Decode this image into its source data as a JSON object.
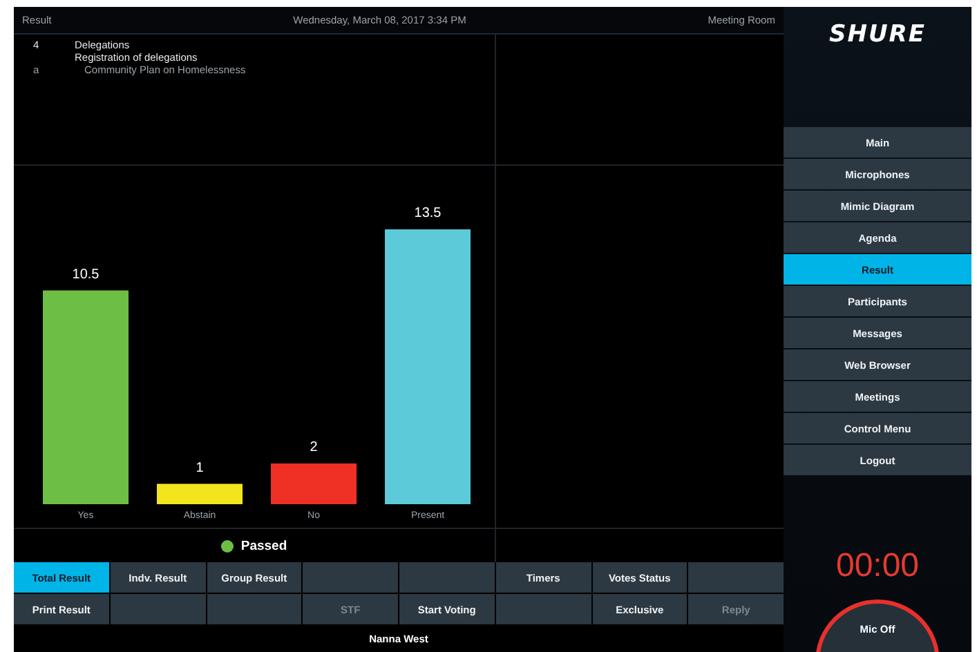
{
  "header": {
    "title": "Result",
    "datetime": "Wednesday, March 08, 2017 3:34 PM",
    "location": "Meeting Room"
  },
  "agenda": {
    "number": "4",
    "title": "Delegations",
    "subtitle": "Registration of delegations",
    "sub_number": "a",
    "sub_title": "Community Plan on Homelessness"
  },
  "chart": {
    "chart_data": {
      "type": "bar",
      "categories": [
        "Yes",
        "Abstain",
        "No",
        "Present"
      ],
      "values": [
        10.5,
        1,
        2,
        13.5
      ],
      "value_labels": [
        "10.5",
        "1",
        "2",
        "13.5"
      ],
      "colors": [
        "#6cbf44",
        "#f2e51e",
        "#ee3124",
        "#5ccad8"
      ],
      "data_labels": true
    }
  },
  "outcome": {
    "label": "Passed",
    "color": "#6cbf44"
  },
  "buttons": [
    [
      {
        "kind": "button",
        "label": "Total Result",
        "selected": true,
        "disabled": false
      },
      {
        "kind": "button",
        "label": "Indv. Result",
        "selected": false,
        "disabled": false
      },
      {
        "kind": "button",
        "label": "Group Result",
        "selected": false,
        "disabled": false
      },
      {
        "kind": "blank"
      },
      {
        "kind": "blank"
      },
      {
        "kind": "button",
        "label": "Timers",
        "selected": false,
        "disabled": false
      },
      {
        "kind": "button",
        "label": "Votes Status",
        "selected": false,
        "disabled": false
      },
      {
        "kind": "blank"
      }
    ],
    [
      {
        "kind": "button",
        "label": "Print Result",
        "selected": false,
        "disabled": false
      },
      {
        "kind": "blank"
      },
      {
        "kind": "blank"
      },
      {
        "kind": "button",
        "label": "STF",
        "selected": false,
        "disabled": true
      },
      {
        "kind": "button",
        "label": "Start Voting",
        "selected": false,
        "disabled": false
      },
      {
        "kind": "blank"
      },
      {
        "kind": "button",
        "label": "Exclusive",
        "selected": false,
        "disabled": false
      },
      {
        "kind": "button",
        "label": "Reply",
        "selected": false,
        "disabled": true
      }
    ]
  ],
  "user": "Nanna West",
  "sidebar": {
    "logo": "SHURE",
    "items": [
      {
        "label": "Main",
        "selected": false
      },
      {
        "label": "Microphones",
        "selected": false
      },
      {
        "label": "Mimic Diagram",
        "selected": false
      },
      {
        "label": "Agenda",
        "selected": false
      },
      {
        "label": "Result",
        "selected": true
      },
      {
        "label": "Participants",
        "selected": false
      },
      {
        "label": "Messages",
        "selected": false
      },
      {
        "label": "Web Browser",
        "selected": false
      },
      {
        "label": "Meetings",
        "selected": false
      },
      {
        "label": "Control Menu",
        "selected": false
      },
      {
        "label": "Logout",
        "selected": false
      }
    ],
    "timer": "00:00",
    "mic_button": "Mic Off"
  }
}
